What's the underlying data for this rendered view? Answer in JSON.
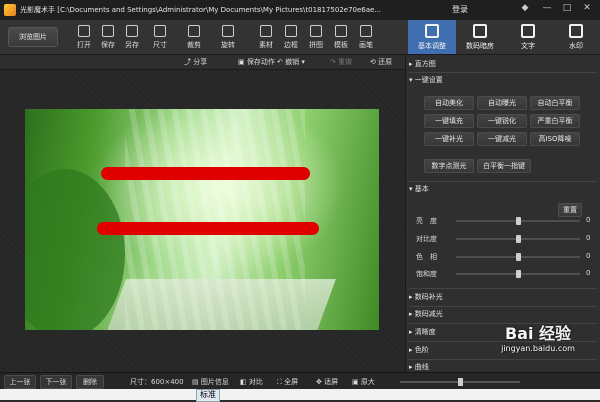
{
  "title_bar": {
    "title": "光影魔术手 [C:\\Documents and Settings\\Administrator\\My Documents\\My Pictures\\t01817502e70e6ae...",
    "login": "登录",
    "controls": [
      "◆",
      "—",
      "□",
      "✕"
    ]
  },
  "toolbar": {
    "browse_label": "浏览图片",
    "tools": [
      "打开",
      "保存",
      "另存",
      "尺寸",
      "裁剪",
      "旋转",
      "素材",
      "边框",
      "拼图",
      "模板",
      "画笔"
    ],
    "tabs": [
      "基本调整",
      "数码暗房",
      "文字",
      "水印"
    ],
    "active_tab": "基本调整"
  },
  "subbar": {
    "share": "分享",
    "save_action": "保存动作",
    "undo": "撤销",
    "redo": "重做",
    "restore": "还原"
  },
  "panel": {
    "histogram": "直方图",
    "one_click": "一键设置",
    "one_click_buttons": [
      "自动美化",
      "自动曝光",
      "自动白平衡",
      "一键填充",
      "一键锐化",
      "严重白平衡",
      "一键补光",
      "一键减光",
      "高ISO降噪"
    ],
    "extra_buttons": [
      "数字点测光",
      "白平衡一指键"
    ],
    "basic": "基本",
    "reset": "重置",
    "sliders": [
      {
        "label": "亮　度",
        "value": "0"
      },
      {
        "label": "对比度",
        "value": "0"
      },
      {
        "label": "色　相",
        "value": "0"
      },
      {
        "label": "饱和度",
        "value": "0"
      }
    ],
    "sections": [
      "数码补光",
      "数码减光",
      "清晰度",
      "色阶",
      "曲线"
    ]
  },
  "statusbar": {
    "prev": "上一张",
    "next": "下一张",
    "delete": "删除",
    "size": "尺寸：600×400",
    "info": "图片信息",
    "compare": "对比",
    "fullscreen": "全屏",
    "fit": "适屏",
    "original": "原大"
  },
  "ime": "标准",
  "watermark": {
    "logo": "Bai 经验",
    "url": "jingyan.baidu.com"
  },
  "colors": {
    "accent_tab": "#3f6fb0",
    "annotation": "#e00000"
  }
}
